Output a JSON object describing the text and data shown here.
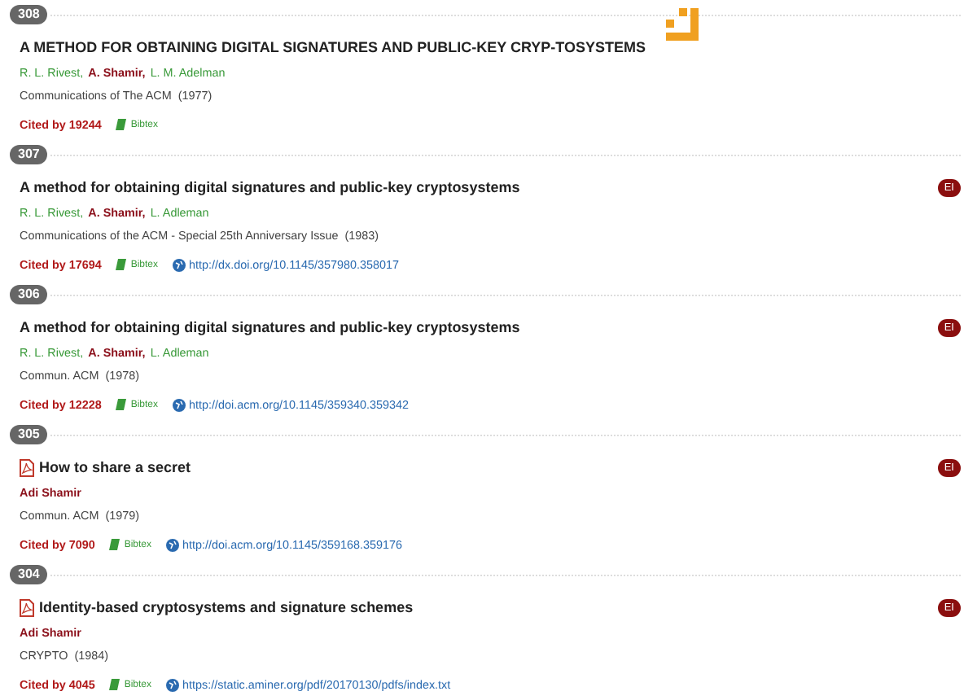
{
  "papers": [
    {
      "number": "308",
      "title": "A METHOD FOR OBTAINING DIGITAL SIGNATURES AND PUBLIC-KEY CRYP-TOSYSTEMS",
      "pdf": false,
      "authors": [
        {
          "name": "R. L. Rivest,",
          "highlighted": false
        },
        {
          "name": "A. Shamir,",
          "highlighted": true
        },
        {
          "name": "L. M. Adelman",
          "highlighted": false
        }
      ],
      "venue": "Communications of The ACM",
      "year": "(1977)",
      "cited": "Cited by 19244",
      "bibtex": "Bibtex"
    },
    {
      "number": "307",
      "title": "A method for obtaining digital signatures and public-key cryptosystems",
      "pdf": false,
      "badge": "EI",
      "authors": [
        {
          "name": "R. L. Rivest,",
          "highlighted": false
        },
        {
          "name": "A. Shamir,",
          "highlighted": true
        },
        {
          "name": "L. Adleman",
          "highlighted": false
        }
      ],
      "venue": "Communications of the ACM - Special 25th Anniversary Issue",
      "year": "(1983)",
      "cited": "Cited by 17694",
      "bibtex": "Bibtex",
      "url": "http://dx.doi.org/10.1145/357980.358017"
    },
    {
      "number": "306",
      "title": "A method for obtaining digital signatures and public-key cryptosystems",
      "pdf": false,
      "badge": "EI",
      "authors": [
        {
          "name": "R. L. Rivest,",
          "highlighted": false
        },
        {
          "name": "A. Shamir,",
          "highlighted": true
        },
        {
          "name": "L. Adleman",
          "highlighted": false
        }
      ],
      "venue": "Commun. ACM",
      "year": "(1978)",
      "cited": "Cited by 12228",
      "bibtex": "Bibtex",
      "url": "http://doi.acm.org/10.1145/359340.359342"
    },
    {
      "number": "305",
      "title": "How to share a secret",
      "pdf": true,
      "badge": "EI",
      "authors": [
        {
          "name": "Adi Shamir",
          "highlighted": true
        }
      ],
      "venue": "Commun. ACM",
      "year": "(1979)",
      "cited": "Cited by 7090",
      "bibtex": "Bibtex",
      "url": "http://doi.acm.org/10.1145/359168.359176"
    },
    {
      "number": "304",
      "title": "Identity-based cryptosystems and signature schemes",
      "pdf": true,
      "badge": "EI",
      "authors": [
        {
          "name": "Adi Shamir",
          "highlighted": true
        }
      ],
      "venue": "CRYPTO",
      "year": "(1984)",
      "cited": "Cited by 4045",
      "bibtex": "Bibtex",
      "url": "https://static.aminer.org/pdf/20170130/pdfs/index.txt"
    }
  ]
}
